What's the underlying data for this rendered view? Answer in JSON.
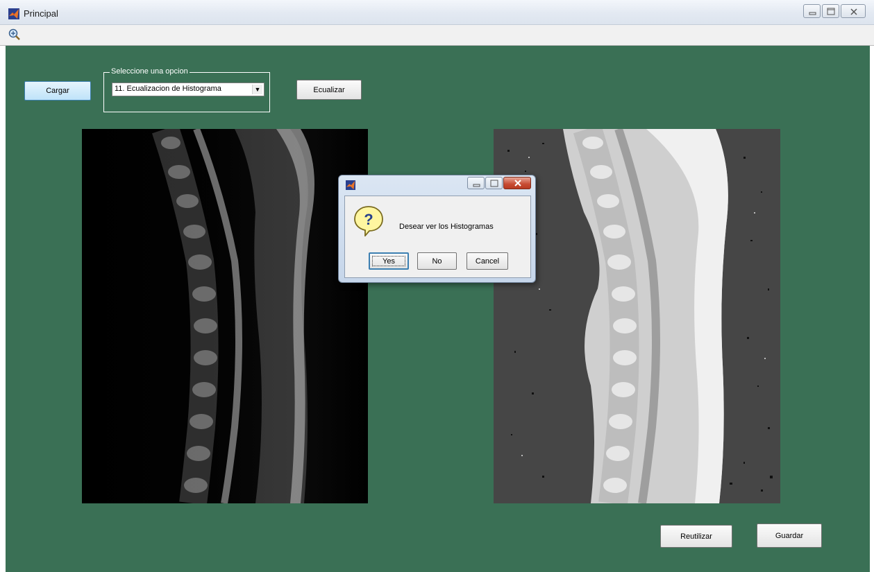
{
  "window": {
    "title": "Principal",
    "controls": [
      "minimize-icon",
      "maximize-icon",
      "close-icon"
    ]
  },
  "toolbar": {
    "icons": [
      "zoom-in-icon"
    ]
  },
  "figure": {
    "background_color": "#3a7055",
    "load_button": "Cargar",
    "options_group_title": "Seleccione una opcion",
    "selected_option": "11. Ecualizacion de Histograma",
    "equalize_button": "Ecualizar",
    "reuse_button": "Reutilizar",
    "save_button": "Guardar",
    "left_image": "original sagittal spine MRI (grayscale, black background)",
    "right_image": "histogram-equalized sagittal spine MRI (gray background)"
  },
  "dialog": {
    "icon": "question-icon",
    "message": "Desear ver los Histogramas",
    "buttons": {
      "yes": "Yes",
      "no": "No",
      "cancel": "Cancel"
    },
    "default_button": "Yes"
  }
}
